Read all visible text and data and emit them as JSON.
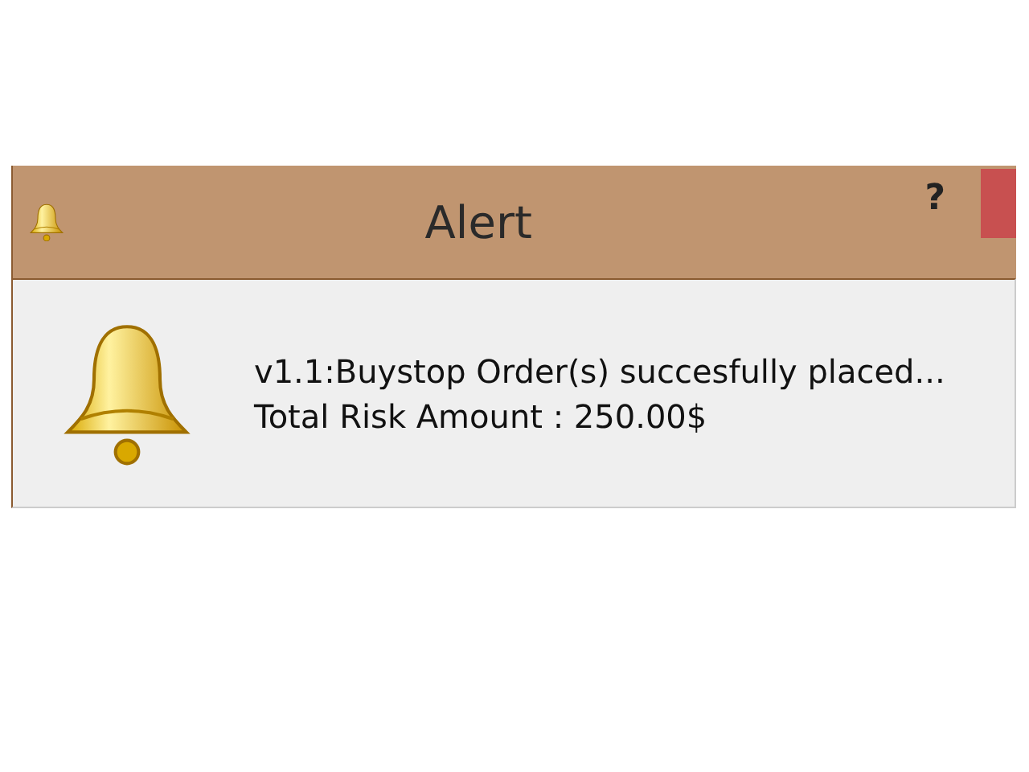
{
  "window": {
    "title": "Alert",
    "help": "?"
  },
  "message": {
    "lines": [
      "v1.1:Buystop Order(s) succesfully placed...",
      "Total Risk Amount : 250.00$"
    ]
  }
}
